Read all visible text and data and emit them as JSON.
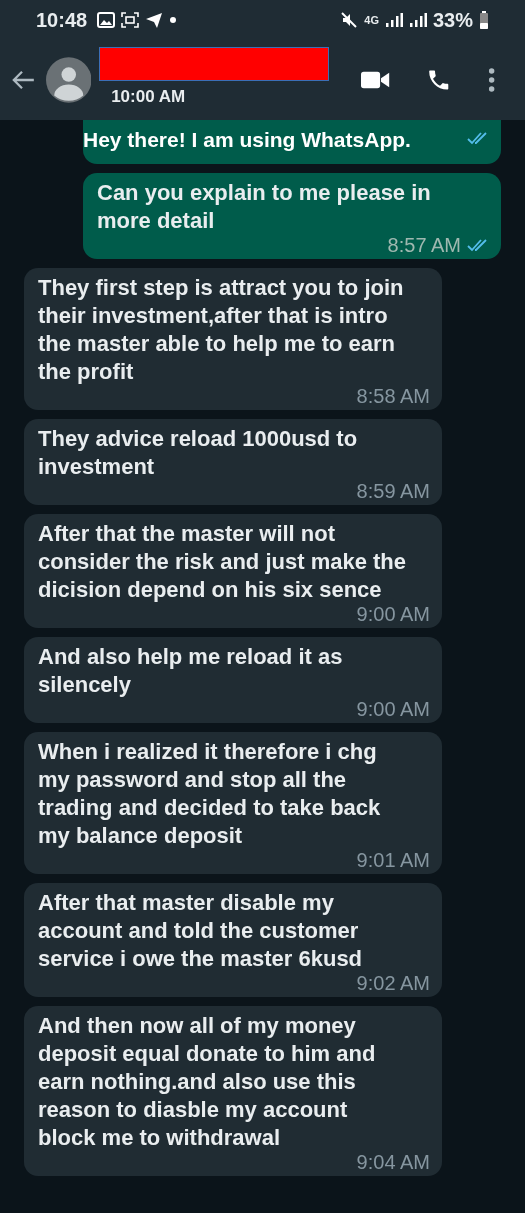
{
  "status_bar": {
    "time": "10:48",
    "battery": "33%",
    "network": "4G"
  },
  "header": {
    "subtitle": "10:00 AM"
  },
  "about_banner": "Hey there! I am using WhatsApp.",
  "messages": [
    {
      "kind": "sent",
      "read": true,
      "cut": true
    },
    {
      "kind": "sent",
      "text": "Can you explain to me please in more detail",
      "time": "8:57 AM",
      "read": true,
      "cut": false
    },
    {
      "kind": "received",
      "text": "They first step is attract you to join their investment,after that is intro the master able to help me to earn the profit",
      "time": "8:58 AM"
    },
    {
      "kind": "received",
      "text": "They advice reload 1000usd to investment",
      "time": "8:59 AM"
    },
    {
      "kind": "received",
      "text": "After that the master will not consider the risk and just make the dicision depend on his six sence",
      "time": "9:00 AM"
    },
    {
      "kind": "received",
      "text": "And also help me reload it as silencely",
      "time": "9:00 AM"
    },
    {
      "kind": "received",
      "text": "When i realized it therefore i chg my password and stop all the trading and decided to take back my balance deposit",
      "time": "9:01 AM"
    },
    {
      "kind": "received",
      "text": "After that master disable my account and told the customer service i owe the master 6kusd",
      "time": "9:02 AM"
    },
    {
      "kind": "received",
      "text": "And then now all of my  money deposit equal donate to him and earn nothing.and also use this reason to diasble my account block me to withdrawal",
      "time": "9:04 AM"
    }
  ]
}
